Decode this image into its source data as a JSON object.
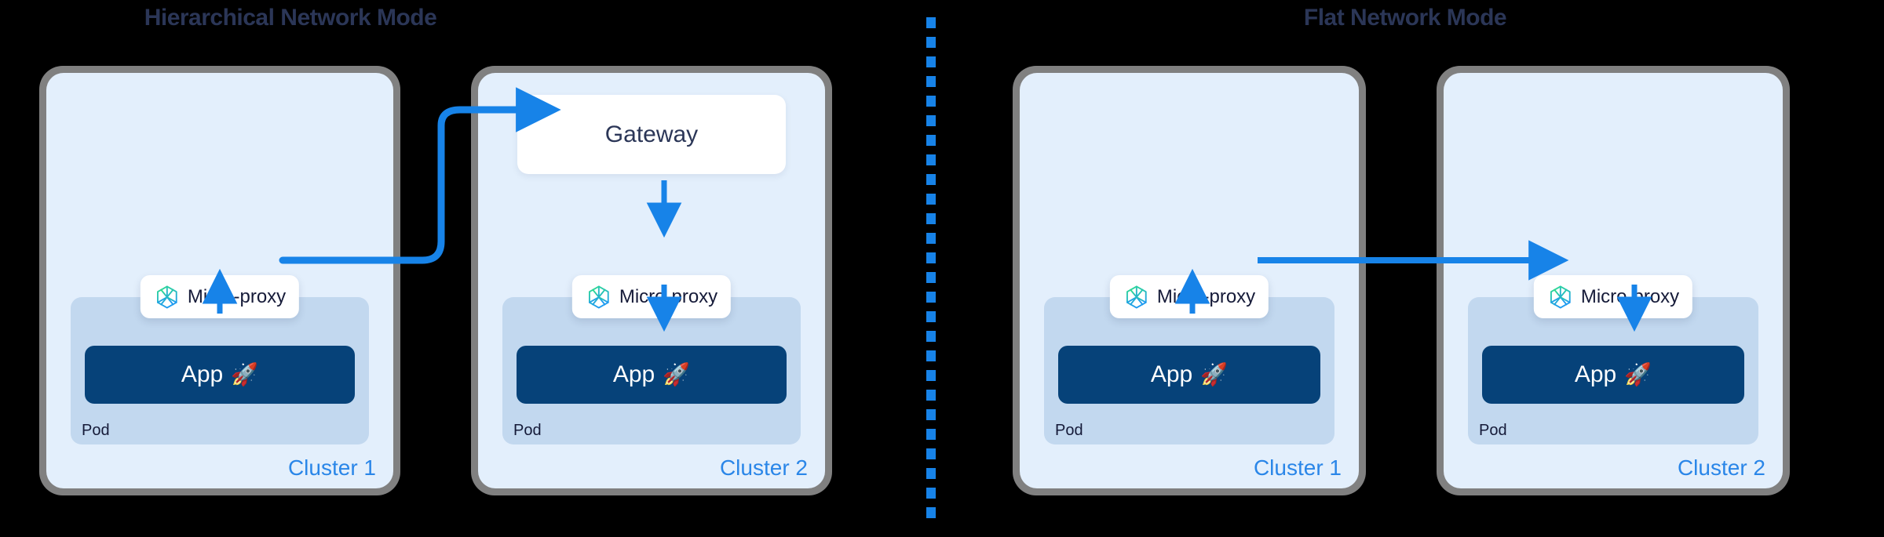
{
  "accent": {
    "arrow_blue": "#1783e8",
    "cluster_label_blue": "#2a86e8",
    "title_navy": "#2b3657",
    "app_navy": "#064279",
    "pod_blue": "#c2d8ef",
    "cluster_bg": "#e3effc",
    "frame_gray": "#808080",
    "icon_green": "#2ee08a",
    "icon_blue": "#1f9bf0",
    "divider_blue": "#1783e8",
    "background": "#000000"
  },
  "panels": [
    {
      "id": "hierarchical",
      "title": "Hierarchical Network Mode",
      "clusters": [
        {
          "label": "Cluster 1",
          "has_gateway": false,
          "gateway_label": "",
          "pod_label": "Pod",
          "microproxy_label": "Micro-proxy",
          "microproxy_icon": "cube-mesh-icon",
          "app_label": "App",
          "app_icon": "rocket-icon"
        },
        {
          "label": "Cluster 2",
          "has_gateway": true,
          "gateway_label": "Gateway",
          "pod_label": "Pod",
          "microproxy_label": "Micro-proxy",
          "microproxy_icon": "cube-mesh-icon",
          "app_label": "App",
          "app_icon": "rocket-icon"
        }
      ]
    },
    {
      "id": "flat",
      "title": "Flat Network Mode",
      "clusters": [
        {
          "label": "Cluster 1",
          "has_gateway": false,
          "gateway_label": "",
          "pod_label": "Pod",
          "microproxy_label": "Micro-proxy",
          "microproxy_icon": "cube-mesh-icon",
          "app_label": "App",
          "app_icon": "rocket-icon"
        },
        {
          "label": "Cluster 2",
          "has_gateway": false,
          "gateway_label": "",
          "pod_label": "Pod",
          "microproxy_label": "Micro-proxy",
          "microproxy_icon": "cube-mesh-icon",
          "app_label": "App",
          "app_icon": "rocket-icon"
        }
      ]
    }
  ],
  "glyphs": {
    "rocket": "🚀"
  },
  "connectors": [
    {
      "name": "h-c1-app-to-microproxy",
      "kind": "arrow-up"
    },
    {
      "name": "h-c1-microproxy-to-c2-gateway",
      "kind": "elbow-arrow-right"
    },
    {
      "name": "h-c2-gateway-to-microproxy",
      "kind": "arrow-down"
    },
    {
      "name": "h-c2-microproxy-to-app",
      "kind": "arrow-down"
    },
    {
      "name": "f-c1-app-to-microproxy",
      "kind": "arrow-up"
    },
    {
      "name": "f-c1-microproxy-to-c2-microproxy",
      "kind": "arrow-right"
    },
    {
      "name": "f-c2-microproxy-to-app",
      "kind": "arrow-down"
    }
  ],
  "divider": {
    "name": "mode-divider",
    "style": "vertical-dashed"
  }
}
